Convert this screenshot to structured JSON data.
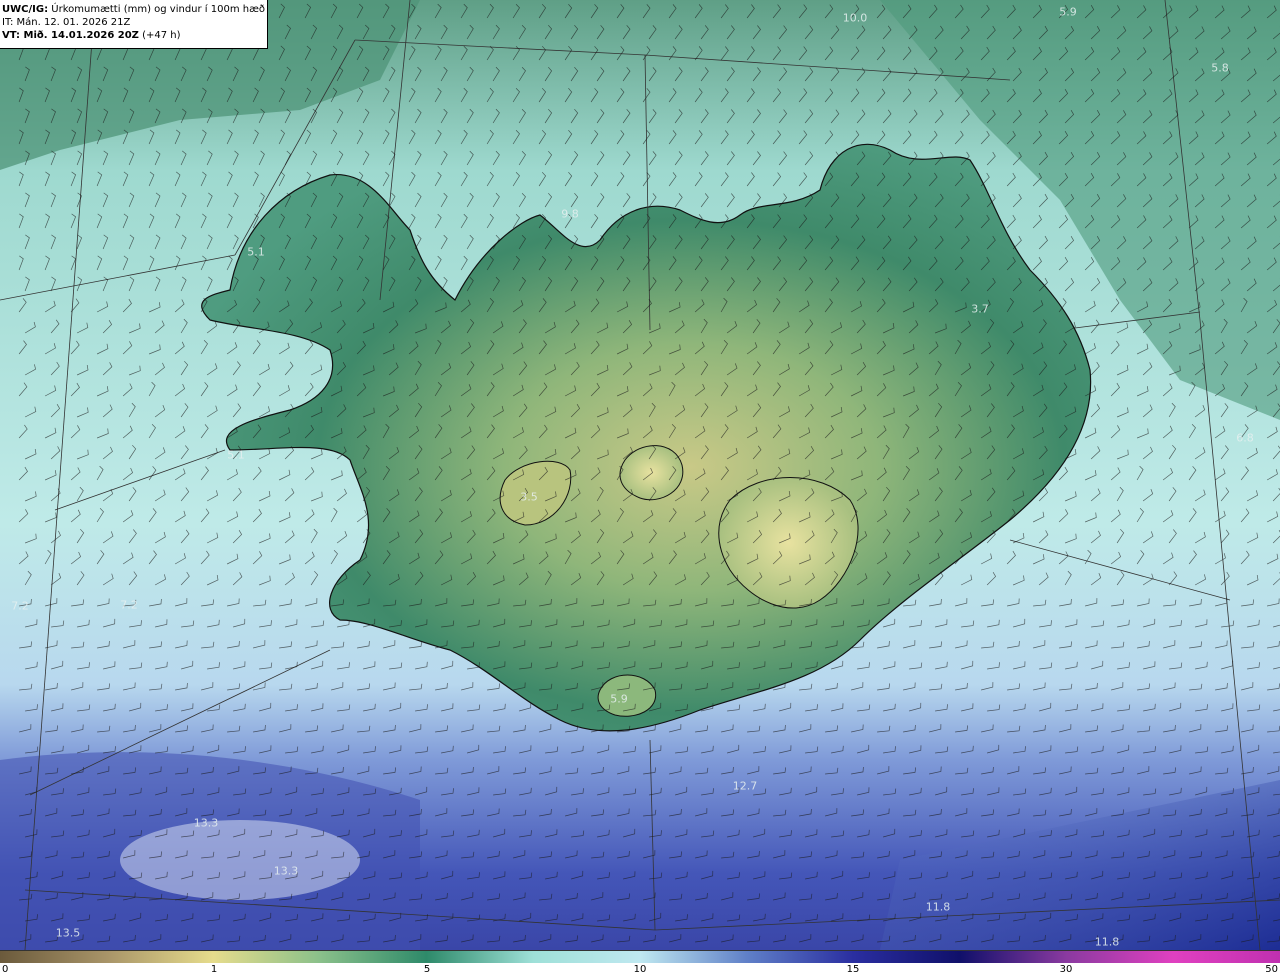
{
  "header": {
    "product_code": "UWC/IG:",
    "product_title": "Úrkomumætti (mm) og vindur í 100m hæð",
    "init_line": "IT: Mán. 12. 01. 2026 21Z",
    "valid_prefix": "VT: Mið. 14.01.2026 20Z",
    "valid_suffix": "(+47 h)"
  },
  "value_labels": [
    "10.0",
    "5.9",
    "5.8",
    "9.8",
    "5.1",
    "3.7",
    "6.8",
    "5.1",
    "3.5",
    "7.2",
    "7.2",
    "5.9",
    "12.7",
    "13.3",
    "13.3",
    "11.8",
    "13.5",
    "11.8"
  ],
  "colorbar": {
    "ticks": [
      "0",
      "1",
      "5",
      "10",
      "15",
      "30",
      "50"
    ],
    "colors": [
      "#6b5a3c",
      "#a89468",
      "#e6dc8c",
      "#8ac08a",
      "#2e8a6a",
      "#9ee0d8",
      "#bfe8f0",
      "#6080c8",
      "#2a2ea0",
      "#10106a",
      "#8a3aa0",
      "#e040c0",
      "#c030b0"
    ]
  },
  "map_colors": {
    "land_high": "#cfcf8a",
    "land_mid": "#5e9e72",
    "land_low": "#3f8567",
    "sea_near": "#a8e3dc",
    "sea_far": "#d5eef0",
    "heavy": "#4c5cbc",
    "coast": "#111111"
  }
}
